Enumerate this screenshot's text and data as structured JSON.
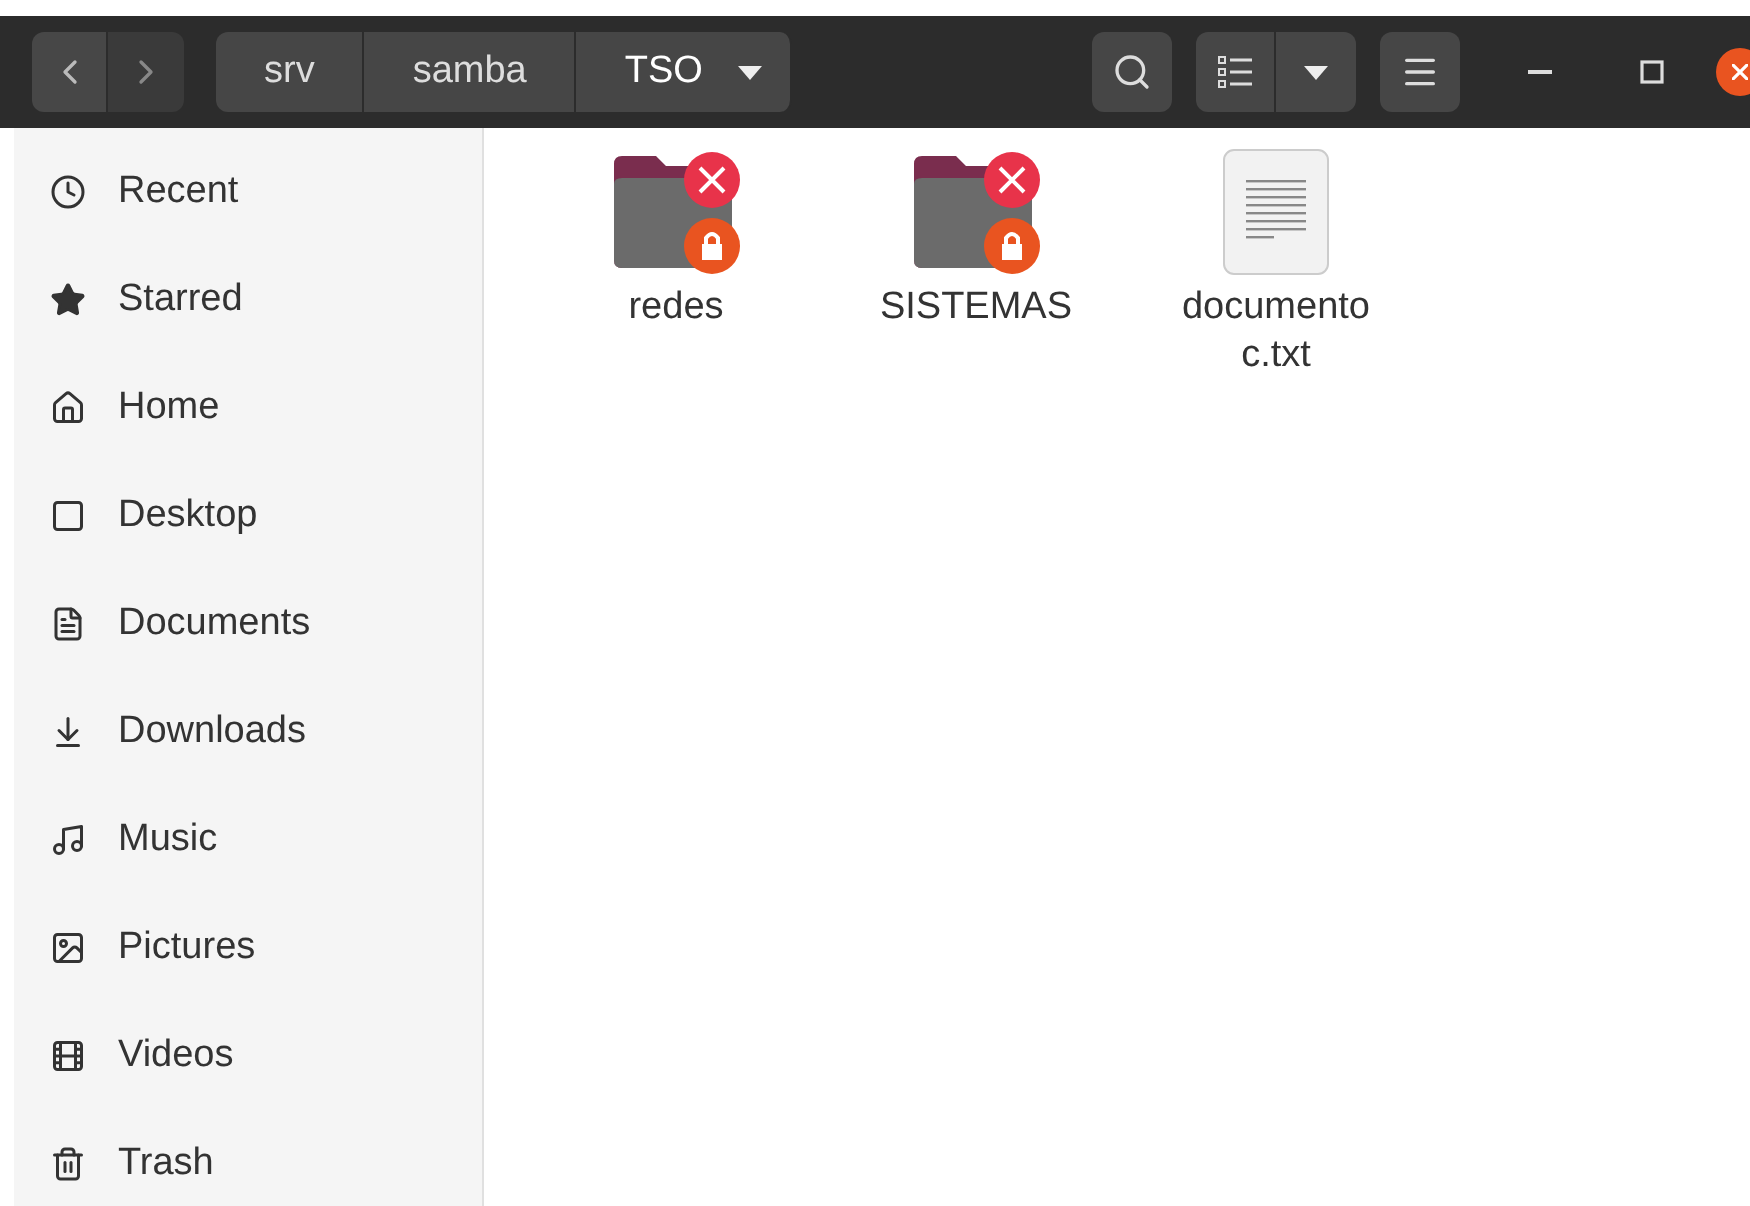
{
  "path": [
    {
      "label": "srv"
    },
    {
      "label": "samba"
    },
    {
      "label": "TSO",
      "current": true
    }
  ],
  "sidebar": {
    "items": [
      {
        "label": "Recent",
        "kind": "recent"
      },
      {
        "label": "Starred",
        "kind": "starred"
      },
      {
        "label": "Home",
        "kind": "home"
      },
      {
        "label": "Desktop",
        "kind": "desktop"
      },
      {
        "label": "Documents",
        "kind": "documents"
      },
      {
        "label": "Downloads",
        "kind": "downloads"
      },
      {
        "label": "Music",
        "kind": "music"
      },
      {
        "label": "Pictures",
        "kind": "pictures"
      },
      {
        "label": "Videos",
        "kind": "videos"
      },
      {
        "label": "Trash",
        "kind": "trash"
      }
    ]
  },
  "files": [
    {
      "name": "redes",
      "kind": "locked-folder"
    },
    {
      "name": "SISTEMAS",
      "kind": "locked-folder"
    },
    {
      "name": "documento\nc.txt",
      "kind": "text-file"
    }
  ]
}
